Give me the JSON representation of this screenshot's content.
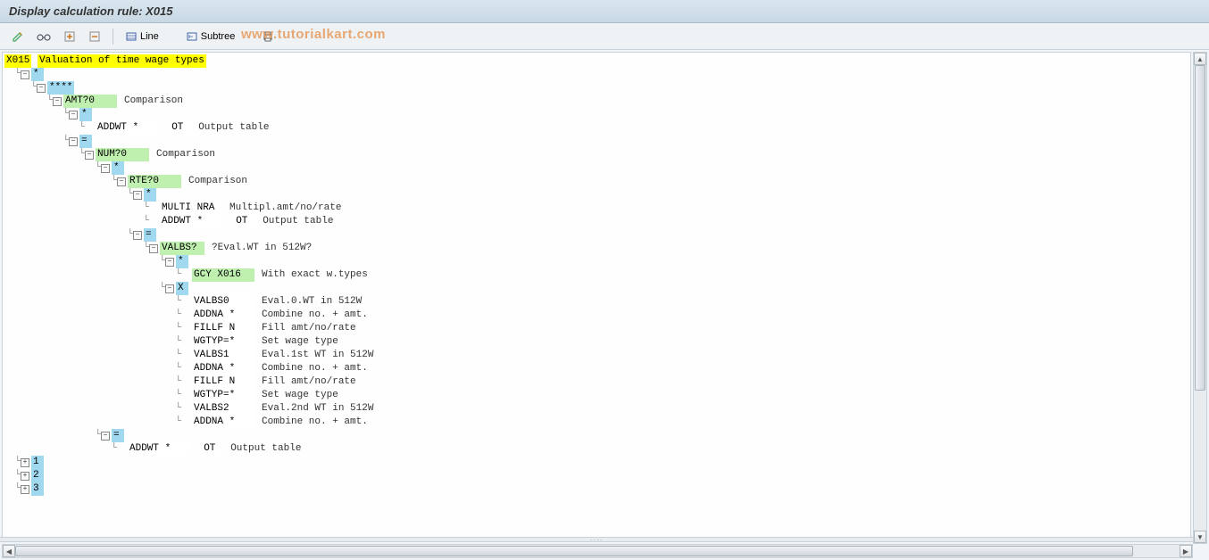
{
  "header": {
    "title": "Display calculation rule: X015"
  },
  "toolbar": {
    "line_label": "Line",
    "subtree_label": "Subtree"
  },
  "watermark": "www.tutorialkart.com",
  "root": {
    "code": "X015",
    "desc": "Valuation of time wage types"
  },
  "lines": [
    {
      "indent": 1,
      "exp": "-",
      "kind": "blue",
      "code": "*",
      "desc": ""
    },
    {
      "indent": 2,
      "exp": "-",
      "kind": "blue",
      "code": "****",
      "desc": ""
    },
    {
      "indent": 3,
      "exp": "-",
      "kind": "green",
      "code": "AMT?0",
      "desc": "Comparison",
      "pad": 60
    },
    {
      "indent": 4,
      "exp": "-",
      "kind": "blue",
      "code": "*",
      "desc": ""
    },
    {
      "indent": 5,
      "exp": "",
      "kind": "white",
      "code": "ADDWT * ",
      "col2": "OT",
      "desc": "Output table"
    },
    {
      "indent": 4,
      "exp": "-",
      "kind": "blue",
      "code": "=",
      "desc": ""
    },
    {
      "indent": 5,
      "exp": "-",
      "kind": "green",
      "code": "NUM?0",
      "desc": "Comparison",
      "pad": 60
    },
    {
      "indent": 6,
      "exp": "-",
      "kind": "blue",
      "code": "*",
      "desc": ""
    },
    {
      "indent": 7,
      "exp": "-",
      "kind": "green",
      "code": "RTE?0",
      "desc": "Comparison",
      "pad": 60
    },
    {
      "indent": 8,
      "exp": "-",
      "kind": "blue",
      "code": "*",
      "desc": ""
    },
    {
      "indent": 9,
      "exp": "",
      "kind": "white",
      "code": "MULTI NRA",
      "desc": "Multipl.amt/no/rate"
    },
    {
      "indent": 9,
      "exp": "",
      "kind": "white",
      "code": "ADDWT * ",
      "col2": "OT",
      "desc": "Output table"
    },
    {
      "indent": 8,
      "exp": "-",
      "kind": "blue",
      "code": "=",
      "desc": ""
    },
    {
      "indent": 9,
      "exp": "-",
      "kind": "green",
      "code": "VALBS?",
      "desc": "?Eval.WT in 512W?",
      "pad": 50
    },
    {
      "indent": 10,
      "exp": "-",
      "kind": "blue",
      "code": "*",
      "desc": ""
    },
    {
      "indent": 11,
      "exp": "",
      "kind": "greenw",
      "code": "GCY X016",
      "desc": "With exact w.types"
    },
    {
      "indent": 10,
      "exp": "-",
      "kind": "blue",
      "code": "X",
      "desc": ""
    },
    {
      "indent": 11,
      "exp": "",
      "kind": "white",
      "code": "VALBS0 ",
      "desc": "Eval.0.WT in 512W"
    },
    {
      "indent": 11,
      "exp": "",
      "kind": "white",
      "code": "ADDNA * ",
      "desc": "Combine no. + amt."
    },
    {
      "indent": 11,
      "exp": "",
      "kind": "white",
      "code": "FILLF N ",
      "desc": "Fill amt/no/rate"
    },
    {
      "indent": 11,
      "exp": "",
      "kind": "white",
      "code": "WGTYP=* ",
      "desc": "Set wage type"
    },
    {
      "indent": 11,
      "exp": "",
      "kind": "white",
      "code": "VALBS1 ",
      "desc": "Eval.1st WT in 512W"
    },
    {
      "indent": 11,
      "exp": "",
      "kind": "white",
      "code": "ADDNA * ",
      "desc": "Combine no. + amt."
    },
    {
      "indent": 11,
      "exp": "",
      "kind": "white",
      "code": "FILLF N ",
      "desc": "Fill amt/no/rate"
    },
    {
      "indent": 11,
      "exp": "",
      "kind": "white",
      "code": "WGTYP=* ",
      "desc": "Set wage type"
    },
    {
      "indent": 11,
      "exp": "",
      "kind": "white",
      "code": "VALBS2 ",
      "desc": "Eval.2nd WT in 512W"
    },
    {
      "indent": 11,
      "exp": "",
      "kind": "white",
      "code": "ADDNA * ",
      "desc": "Combine no. + amt."
    },
    {
      "indent": 6,
      "exp": "-",
      "kind": "blue",
      "code": "=",
      "desc": ""
    },
    {
      "indent": 7,
      "exp": "",
      "kind": "white",
      "code": "ADDWT * ",
      "col2": "OT",
      "desc": "Output table"
    },
    {
      "indent": 1,
      "exp": "+",
      "kind": "blue",
      "code": "1",
      "desc": ""
    },
    {
      "indent": 1,
      "exp": "+",
      "kind": "blue",
      "code": "2",
      "desc": ""
    },
    {
      "indent": 1,
      "exp": "+",
      "kind": "blue",
      "code": "3",
      "desc": ""
    }
  ]
}
